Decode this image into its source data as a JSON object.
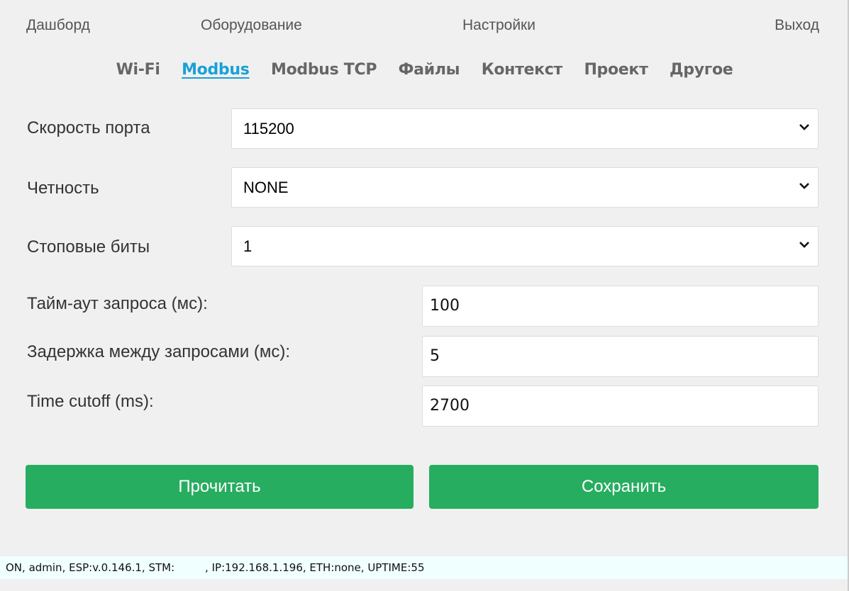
{
  "nav": {
    "dashboard": "Дашборд",
    "equipment": "Оборудование",
    "settings": "Настройки",
    "exit": "Выход"
  },
  "tabs": [
    {
      "label": "Wi-Fi",
      "active": false
    },
    {
      "label": "Modbus",
      "active": true
    },
    {
      "label": "Modbus TCP",
      "active": false
    },
    {
      "label": "Файлы",
      "active": false
    },
    {
      "label": "Контекст",
      "active": false
    },
    {
      "label": "Проект",
      "active": false
    },
    {
      "label": "Другое",
      "active": false
    }
  ],
  "form": {
    "baud": {
      "label": "Скорость порта",
      "value": "115200"
    },
    "parity": {
      "label": "Четность",
      "value": "NONE"
    },
    "stopbits": {
      "label": "Стоповые биты",
      "value": "1"
    },
    "timeout": {
      "label": "Тайм-аут запроса (мс):",
      "value": "100"
    },
    "delay": {
      "label": "Задержка между запросами (мс):",
      "value": "5"
    },
    "cutoff": {
      "label": "Time cutoff (ms):",
      "value": "2700"
    }
  },
  "buttons": {
    "read": "Прочитать",
    "save": "Сохранить"
  },
  "status_bar": "ON, admin, ESP:v.0.146.1, STM:         , IP:192.168.1.196, ETH:none, UPTIME:55",
  "colors": {
    "accent": "#1aa0d8",
    "button": "#27ad60",
    "status_bg": "#f0ffff"
  }
}
